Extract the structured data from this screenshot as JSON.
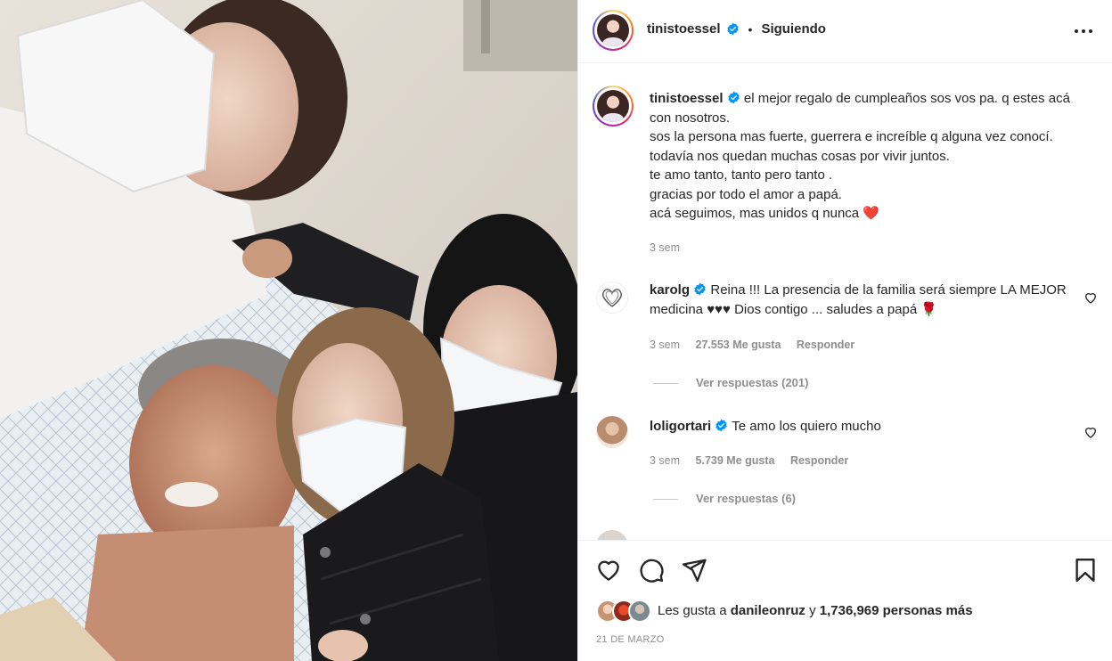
{
  "post": {
    "photo_alt": ""
  },
  "header": {
    "username": "tinistoessel",
    "separator": "•",
    "follow_status": "Siguiendo",
    "more_icon": "more-horizontal-icon"
  },
  "caption": {
    "username": "tinistoessel",
    "lines": [
      "el mejor regalo de cumpleaños sos vos pa. q estes acá con nosotros.",
      "sos la persona mas fuerte, guerrera e increíble q alguna vez conocí.",
      "todavía nos quedan muchas cosas por vivir juntos.",
      "te amo tanto, tanto pero tanto .",
      "gracias por todo el amor a papá.",
      "acá seguimos, mas unidos q nunca"
    ],
    "emoji_end": "❤️",
    "time": "3 sem"
  },
  "comments": [
    {
      "username": "karolg",
      "text": "Reina !!! La presencia de la familia será siempre LA MEJOR medicina ♥♥♥ Dios contigo ... saludes a papá",
      "emoji_end": "🌹",
      "time": "3 sem",
      "likes": "27.553 Me gusta",
      "reply": "Responder",
      "view_replies": "Ver respuestas (201)"
    },
    {
      "username": "loligortari",
      "text": "Te amo los quiero mucho",
      "time": "3 sem",
      "likes": "5.739 Me gusta",
      "reply": "Responder",
      "view_replies": "Ver respuestas (6)"
    }
  ],
  "actions": {
    "like_icon": "heart-icon",
    "comment_icon": "comment-icon",
    "share_icon": "send-icon",
    "save_icon": "bookmark-icon"
  },
  "likes": {
    "prefix": "Les gusta a",
    "user": "danileonruz",
    "conj": "y",
    "count": "1,736,969 personas más"
  },
  "date": "21 DE MARZO",
  "colors": {
    "verified": "#0095f6",
    "heart_red": "#ed4956",
    "border": "#efefef",
    "muted": "#8e8e8e"
  }
}
